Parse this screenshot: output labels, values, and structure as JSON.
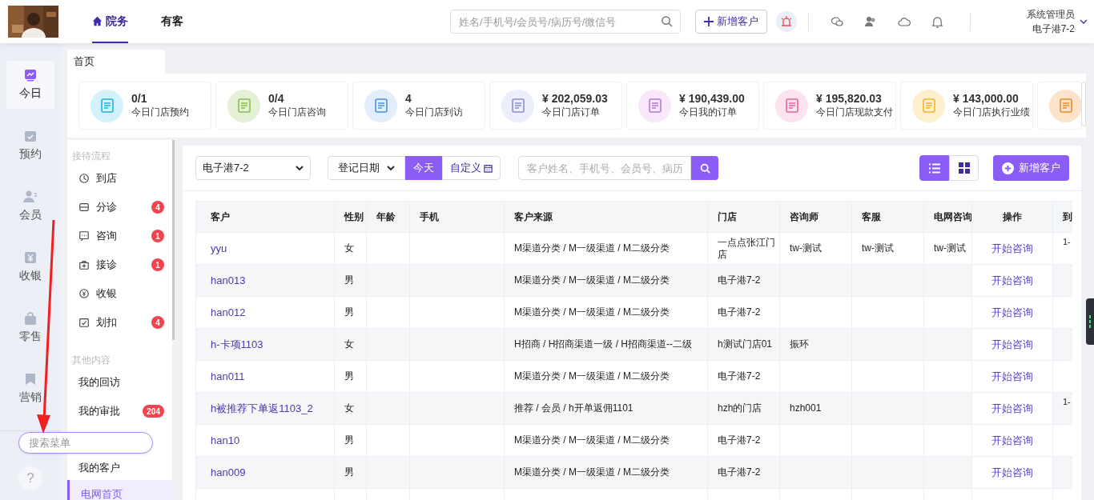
{
  "header": {
    "nav_tabs": [
      {
        "label": "院务",
        "selected": true
      },
      {
        "label": "有客",
        "selected": false
      }
    ],
    "search": {
      "placeholder": "姓名/手机号/会员号/病历号/微信号"
    },
    "add_button": "新增客户",
    "user": {
      "name": "系统管理员",
      "store": "电子港7-2"
    }
  },
  "rail": {
    "items": [
      {
        "label": "今日",
        "selected": true
      },
      {
        "label": "预约",
        "selected": false
      },
      {
        "label": "会员",
        "selected": false
      },
      {
        "label": "收银",
        "selected": false
      },
      {
        "label": "零售",
        "selected": false
      },
      {
        "label": "营销",
        "selected": false
      }
    ],
    "menu_search": {
      "placeholder": "搜索菜单"
    },
    "help": "?"
  },
  "page_tabs": [
    {
      "label": "首页",
      "selected": true
    }
  ],
  "stats": [
    {
      "value": "0/1",
      "label": "今日门店预约",
      "color": "#d3f2fb"
    },
    {
      "value": "0/4",
      "label": "今日门店咨询",
      "color": "#e5f1d6"
    },
    {
      "value": "4",
      "label": "今日门店到访",
      "color": "#e2eefc"
    },
    {
      "value": "¥ 202,059.03",
      "label": "今日门店订单",
      "color": "#eceefb"
    },
    {
      "value": "¥ 190,439.00",
      "label": "今日我的订单",
      "color": "#fbe7fb"
    },
    {
      "value": "¥ 195,820.03",
      "label": "今日门店现款支付",
      "color": "#fce3ef"
    },
    {
      "value": "¥ 143,000.00",
      "label": "今日门店执行业绩",
      "color": "#fef0cf"
    },
    {
      "color": "#fde3c9"
    }
  ],
  "submenu": {
    "sections": [
      {
        "title": "接待流程",
        "items": [
          {
            "label": "到店",
            "kind": "icon"
          },
          {
            "label": "分诊",
            "badge": "4",
            "kind": "icon"
          },
          {
            "label": "咨询",
            "badge": "1",
            "kind": "icon"
          },
          {
            "label": "接诊",
            "badge": "1",
            "kind": "icon"
          },
          {
            "label": "收银",
            "kind": "icon"
          },
          {
            "label": "划扣",
            "badge": "4",
            "kind": "icon"
          }
        ]
      },
      {
        "title": "其他内容",
        "items": [
          {
            "label": "我的回访",
            "kind": "text",
            "selected": false
          },
          {
            "label": "我的审批",
            "badge": "204",
            "kind": "text",
            "selected": false
          },
          {
            "kind": "hidden"
          },
          {
            "label": "我的客户",
            "kind": "text",
            "selected": false
          },
          {
            "label": "电网首页",
            "kind": "text",
            "selected": true
          }
        ]
      }
    ]
  },
  "toolbar": {
    "store_select": "电子港7-2",
    "date_select": "登记日期",
    "date_buttons": [
      {
        "label": "今天",
        "selected": true
      },
      {
        "label": "自定义",
        "selected": false
      }
    ],
    "search": {
      "placeholder": "客户姓名、手机号、会员号、病历"
    },
    "views": [
      {
        "kind": "list",
        "selected": true
      },
      {
        "kind": "grid",
        "selected": false
      }
    ],
    "add_button": "新增客户"
  },
  "table": {
    "columns": [
      "客户",
      "性别",
      "年龄",
      "手机",
      "客户来源",
      "门店",
      "咨询师",
      "客服",
      "电网咨询",
      "操作",
      "到"
    ],
    "rows": [
      [
        "yyu",
        "女",
        "",
        "",
        "M渠道分类 / M一级渠道 / M二级分类",
        "一点点张江门店",
        "tw-测试",
        "tw-测试",
        "tw-测试",
        "开始咨询",
        "1-"
      ],
      [
        "han013",
        "男",
        "",
        "",
        "M渠道分类 / M一级渠道 / M二级分类",
        "电子港7-2",
        "",
        "",
        "",
        "开始咨询",
        ""
      ],
      [
        "han012",
        "男",
        "",
        "",
        "M渠道分类 / M一级渠道 / M二级分类",
        "电子港7-2",
        "",
        "",
        "",
        "开始咨询",
        ""
      ],
      [
        "h-卡项1103",
        "女",
        "",
        "",
        "H招商 / H招商渠道一级 / H招商渠道--二级",
        "h测试门店01",
        "振环",
        "",
        "",
        "开始咨询",
        ""
      ],
      [
        "han011",
        "男",
        "",
        "",
        "M渠道分类 / M一级渠道 / M二级分类",
        "电子港7-2",
        "",
        "",
        "",
        "开始咨询",
        ""
      ],
      [
        "h被推荐下单返1103_2",
        "女",
        "",
        "",
        "推荐 / 会员 / h开单返佣1101",
        "hzh的门店",
        "hzh001",
        "",
        "",
        "开始咨询",
        "1-"
      ],
      [
        "han10",
        "男",
        "",
        "",
        "M渠道分类 / M一级渠道 / M二级分类",
        "电子港7-2",
        "",
        "",
        "",
        "开始咨询",
        ""
      ],
      [
        "han009",
        "男",
        "",
        "",
        "M渠道分类 / M一级渠道 / M二级分类",
        "电子港7-2",
        "",
        "",
        "",
        "开始咨询",
        ""
      ],
      [
        "",
        "",
        "",
        "",
        "",
        "",
        "",
        "",
        "",
        "",
        ""
      ]
    ]
  }
}
